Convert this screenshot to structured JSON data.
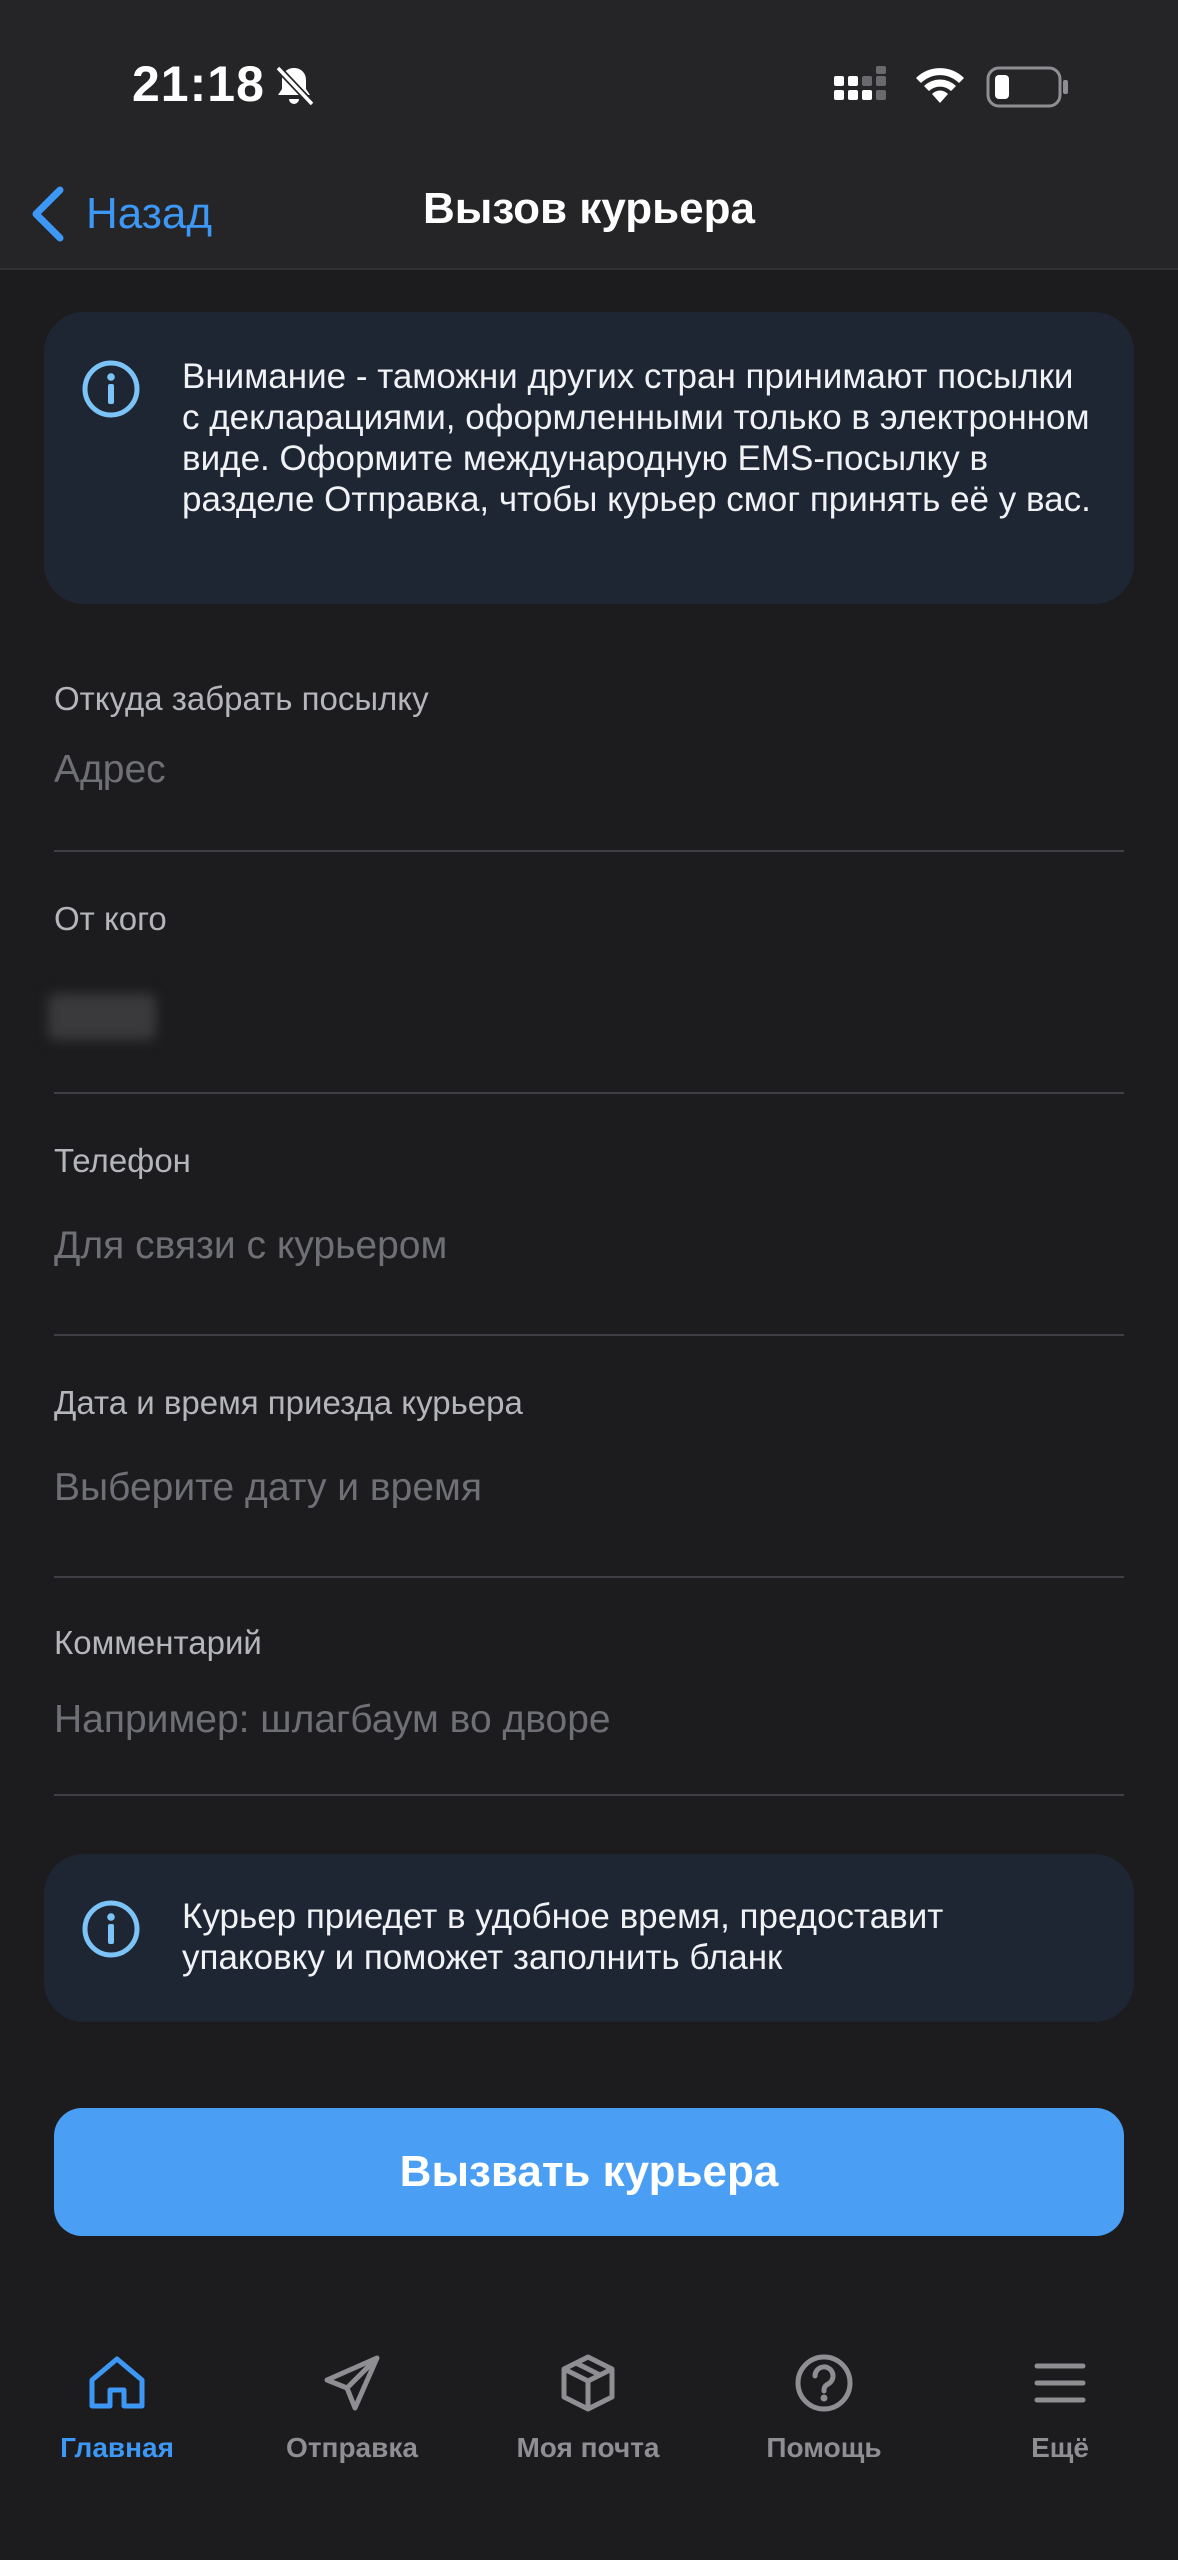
{
  "status_bar": {
    "time": "21:18"
  },
  "nav": {
    "back_label": "Назад",
    "title": "Вызов курьера"
  },
  "notice_top": {
    "text": "Внимание - таможни других стран принимают посылки с декларациями, оформленными только в электронном виде. Оформите международную EMS-посылку в разделе Отправка, чтобы курьер смог принять её у вас."
  },
  "form": {
    "pickup": {
      "label": "Откуда забрать посылку",
      "placeholder": "Адрес",
      "value": ""
    },
    "sender": {
      "label": "От кого"
    },
    "phone": {
      "label": "Телефон",
      "placeholder": "Для связи с курьером",
      "value": ""
    },
    "datetime": {
      "label": "Дата и время приезда курьера",
      "placeholder": "Выберите дату и время",
      "value": ""
    },
    "comment": {
      "label": "Комментарий",
      "placeholder": "Например: шлагбаум во дворе",
      "value": ""
    }
  },
  "notice_bottom": {
    "text": "Курьер приедет в удобное время, предоставит упаковку и поможет заполнить бланк"
  },
  "cta": {
    "label": "Вызвать курьера"
  },
  "tabs": [
    {
      "label": "Главная",
      "icon": "home-icon",
      "active": true
    },
    {
      "label": "Отправка",
      "icon": "paper-plane-icon",
      "active": false
    },
    {
      "label": "Моя почта",
      "icon": "package-icon",
      "active": false
    },
    {
      "label": "Помощь",
      "icon": "help-icon",
      "active": false
    },
    {
      "label": "Ещё",
      "icon": "menu-icon",
      "active": false
    }
  ],
  "colors": {
    "accent": "#3d97f5",
    "button": "#4a9ff5",
    "background": "#1c1c1e",
    "info_box": "#1f2633"
  }
}
